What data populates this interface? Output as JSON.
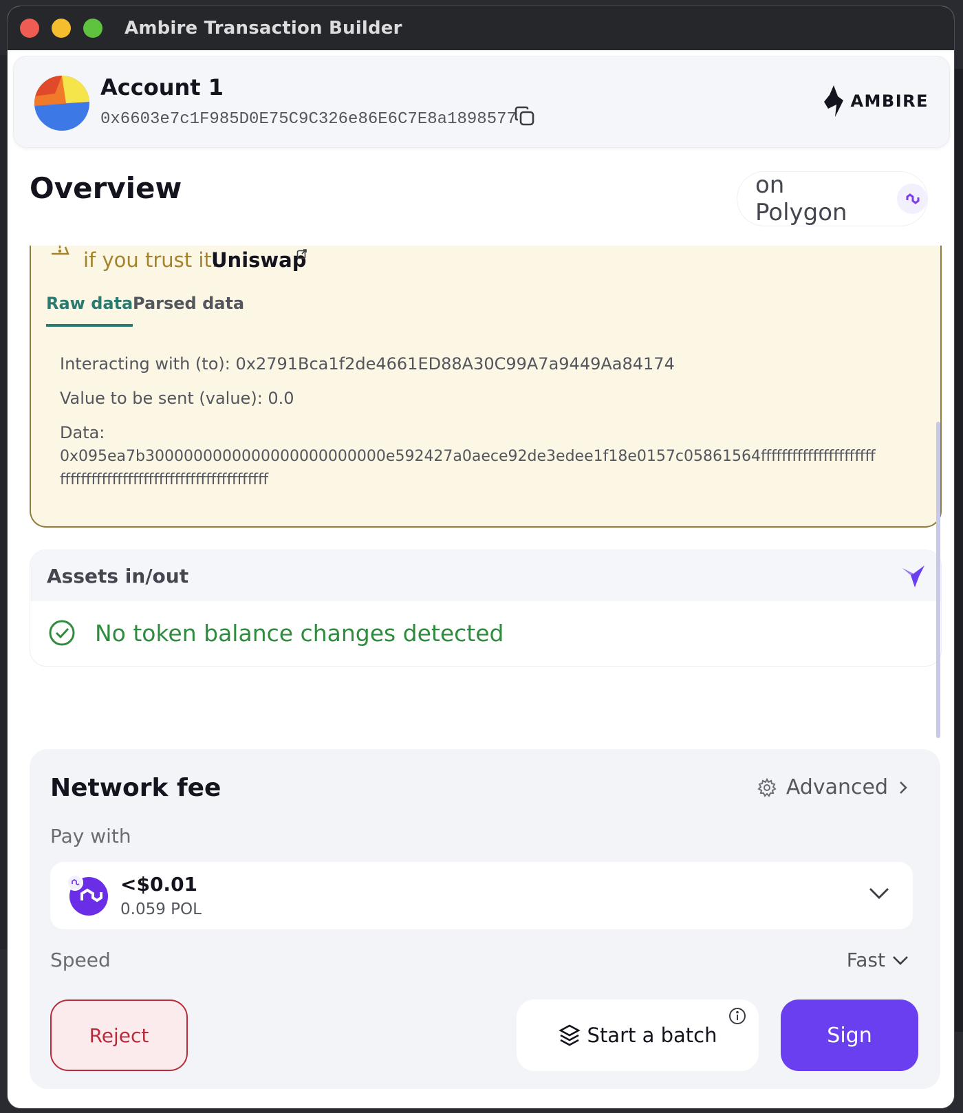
{
  "window": {
    "title": "Ambire Transaction Builder"
  },
  "account": {
    "name": "Account 1",
    "address": "0x6603e7c1F985D0E75C9C326e86E6C7E8a1898577",
    "brand": "AMBIRE"
  },
  "overview": {
    "title": "Overview",
    "network_label": "on Polygon"
  },
  "warning": {
    "text": "if you trust it.",
    "link": "Uniswap"
  },
  "tabs": [
    {
      "label": "Raw data",
      "active": true
    },
    {
      "label": "Parsed data",
      "active": false
    }
  ],
  "raw": {
    "to_line": "Interacting with (to): 0x2791Bca1f2de4661ED88A30C99A7a9449Aa84174",
    "value_line": "Value to be sent (value): 0.0",
    "data_label": "Data:",
    "data_value": "0x095ea7b3000000000000000000000000e592427a0aece92de3edee1f18e0157c05861564ffffffffffffffffffffffffffffffffffffffffffffffffffffffffffffff"
  },
  "assets": {
    "title": "Assets in/out",
    "status": "No token balance changes detected"
  },
  "fee": {
    "title": "Network fee",
    "advanced_label": "Advanced",
    "pay_with_label": "Pay with",
    "token_usd": "<$0.01",
    "token_amount": "0.059 POL",
    "speed_label": "Speed",
    "speed_value": "Fast"
  },
  "actions": {
    "reject": "Reject",
    "batch": "Start a batch",
    "sign": "Sign"
  },
  "colors": {
    "accent": "#6a3ff0",
    "success": "#2f8c3e",
    "danger": "#b62c3c",
    "warning_bg": "#fcf6e4",
    "tab_active": "#2b7a6f"
  }
}
